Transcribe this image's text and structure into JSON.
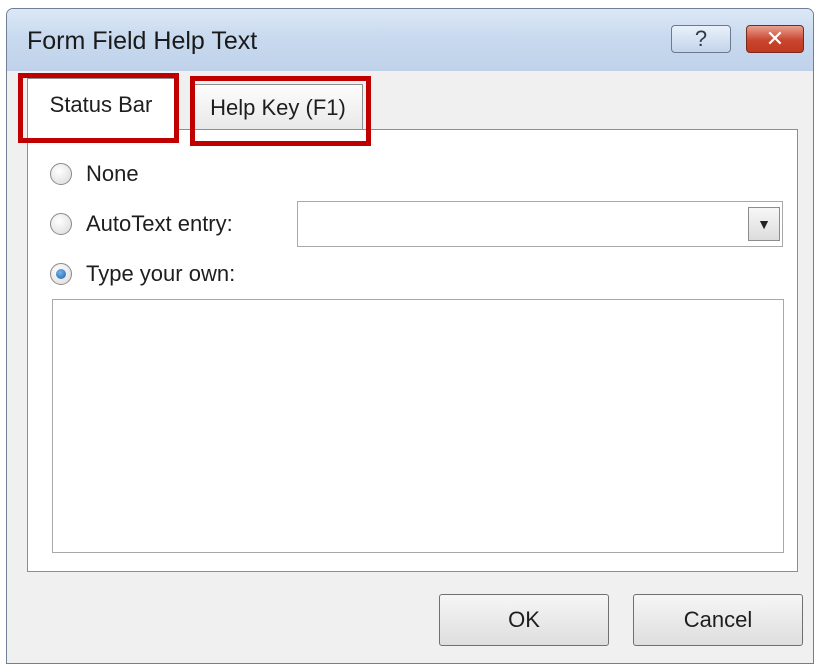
{
  "window": {
    "title": "Form Field Help Text",
    "help_button_label": "?",
    "close_button_label": "✕"
  },
  "tabs": [
    {
      "label": "Status Bar",
      "selected": true
    },
    {
      "label": "Help Key (F1)",
      "selected": false
    }
  ],
  "options": {
    "none_label": "None",
    "autotext_label": "AutoText entry:",
    "type_own_label": "Type your own:",
    "selected": "Type your own:"
  },
  "autotext_combo": {
    "value": "",
    "arrow_icon": "▼"
  },
  "custom_text": {
    "value": ""
  },
  "buttons": {
    "ok_label": "OK",
    "cancel_label": "Cancel"
  },
  "colors": {
    "highlight": "#c00000",
    "title_bar": "#c9daef",
    "close_button": "#c9452e"
  }
}
